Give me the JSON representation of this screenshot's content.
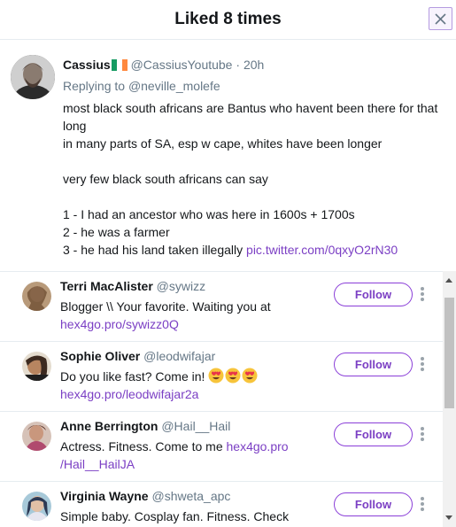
{
  "dialog": {
    "title": "Liked 8 times",
    "close_icon": "close-icon"
  },
  "tweet": {
    "name": "Cassius",
    "flag": "ireland-flag-emoji",
    "handle": "@CassiusYoutube",
    "separator": "·",
    "time": "20h",
    "replying_prefix": "Replying to",
    "replying_to": "@neville_molefe",
    "lines": [
      "most black south africans are Bantus who havent been there for that long",
      "in many parts of SA, esp w cape, whites have been longer",
      "",
      "very few black south africans can say",
      "",
      "1 - I had an ancestor who was here in 1600s + 1700s",
      "2 - he was a farmer",
      "3 - he had his land taken illegally"
    ],
    "link": "pic.twitter.com/0qxyO2rN30"
  },
  "likers": [
    {
      "name": "Terri MacAlister",
      "handle": "@sywizz",
      "bio_text": "Blogger \\\\ Your favorite. Waiting you at",
      "bio_link": "hex4go.pro/sywizz0Q",
      "follow_label": "Follow"
    },
    {
      "name": "Sophie Oliver",
      "handle": "@leodwifajar",
      "bio_text": "Do you like fast? Come in!",
      "bio_emojis": [
        "heart-eyes-emoji",
        "heart-eyes-emoji",
        "heart-eyes-emoji"
      ],
      "bio_link": "hex4go.pro/leodwifajar2a",
      "follow_label": "Follow"
    },
    {
      "name": "Anne Berrington",
      "handle": "@Hail__Hail",
      "bio_text": "Actress. Fitness. Come to me",
      "bio_link_a": "hex4go.pro",
      "bio_link_b": "/Hail__HailJA",
      "follow_label": "Follow"
    },
    {
      "name": "Virginia Wayne",
      "handle": "@shweta_apc",
      "bio_text": "Simple baby. Cosplay fan. Fitness. Check",
      "follow_label": "Follow"
    }
  ],
  "colors": {
    "accent": "#7b3fc4",
    "muted": "#657786",
    "text": "#14171a"
  }
}
